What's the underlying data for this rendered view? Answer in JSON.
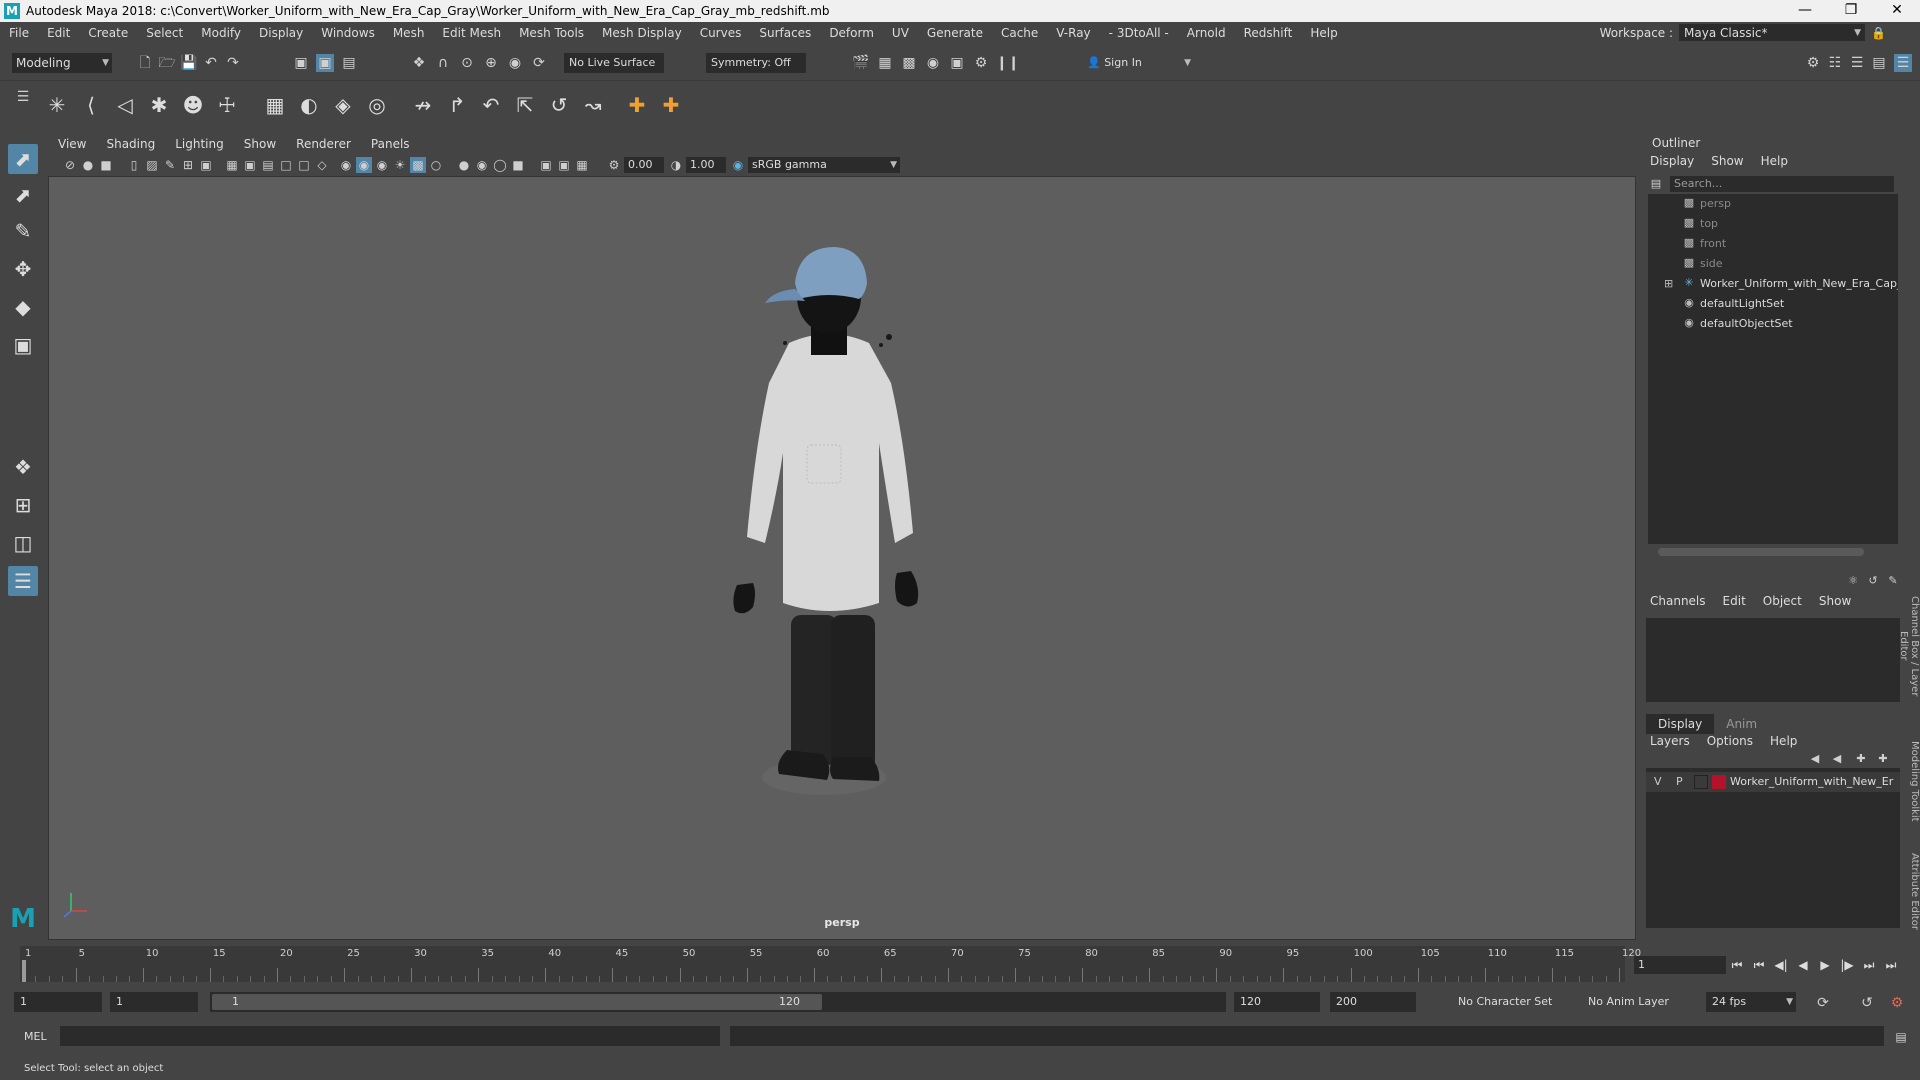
{
  "window": {
    "title": "Autodesk Maya 2018: c:\\Convert\\Worker_Uniform_with_New_Era_Cap_Gray\\Worker_Uniform_with_New_Era_Cap_Gray_mb_redshift.mb",
    "app_icon_letter": "M"
  },
  "menubar": {
    "items": [
      "File",
      "Edit",
      "Create",
      "Select",
      "Modify",
      "Display",
      "Windows",
      "Mesh",
      "Edit Mesh",
      "Mesh Tools",
      "Mesh Display",
      "Curves",
      "Surfaces",
      "Deform",
      "UV",
      "Generate",
      "Cache",
      "V-Ray",
      "- 3DtoAll -",
      "Arnold",
      "Redshift",
      "Help"
    ],
    "workspace_label": "Workspace :",
    "workspace_value": "Maya Classic*"
  },
  "statusline": {
    "mode": "Modeling",
    "live_surface": "No Live Surface",
    "symmetry": "Symmetry: Off",
    "sign_in": "Sign In"
  },
  "viewport": {
    "panel_menu": [
      "View",
      "Shading",
      "Lighting",
      "Show",
      "Renderer",
      "Panels"
    ],
    "exposure": "0.00",
    "gamma": "1.00",
    "color_space": "sRGB gamma",
    "camera": "persp"
  },
  "outliner": {
    "title": "Outliner",
    "menu": [
      "Display",
      "Show",
      "Help"
    ],
    "search_placeholder": "Search...",
    "items": [
      {
        "label": "persp",
        "kind": "camera"
      },
      {
        "label": "top",
        "kind": "camera"
      },
      {
        "label": "front",
        "kind": "camera"
      },
      {
        "label": "side",
        "kind": "camera"
      },
      {
        "label": "Worker_Uniform_with_New_Era_Cap_Gr",
        "kind": "group"
      },
      {
        "label": "defaultLightSet",
        "kind": "set"
      },
      {
        "label": "defaultObjectSet",
        "kind": "set"
      }
    ]
  },
  "channelbox": {
    "menu": [
      "Channels",
      "Edit",
      "Object",
      "Show"
    ]
  },
  "layereditor": {
    "tabs": [
      "Display",
      "Anim"
    ],
    "menu": [
      "Layers",
      "Options",
      "Help"
    ],
    "layer": {
      "v": "V",
      "p": "P",
      "name": "Worker_Uniform_with_New_Er",
      "color": "#b3122a"
    }
  },
  "side_tabs": [
    "Channel Box / Layer Editor",
    "Modeling Toolkit",
    "Attribute Editor"
  ],
  "timeslider": {
    "ticks": [
      1,
      5,
      10,
      15,
      20,
      25,
      30,
      35,
      40,
      45,
      50,
      55,
      60,
      65,
      70,
      75,
      80,
      85,
      90,
      95,
      100,
      105,
      110,
      115,
      120
    ],
    "start": 1,
    "end": 120,
    "current_frame": "1"
  },
  "rangeslider": {
    "start_field": "1",
    "playback_start_field": "1",
    "range_start": "1",
    "range_end": "120",
    "playback_end_field": "120",
    "anim_end_field": "200",
    "character_set": "No Character Set",
    "anim_layer": "No Anim Layer",
    "fps": "24 fps"
  },
  "cmdline": {
    "language": "MEL"
  },
  "helpline": {
    "text": "Select Tool: select an object"
  },
  "colors": {
    "accent": "#5285a6",
    "viewport_bg": "#5e5e5e",
    "panel_bg": "#444444",
    "field_bg": "#2b2b2b"
  }
}
